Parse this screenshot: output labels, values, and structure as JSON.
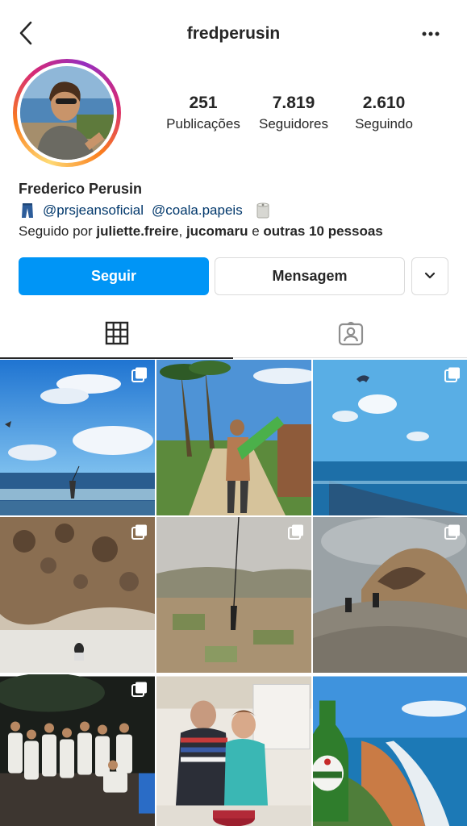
{
  "profile": {
    "username": "fredperusin",
    "name": "Frederico Perusin",
    "stats": [
      {
        "value": "251",
        "label": "Publicações"
      },
      {
        "value": "7.819",
        "label": "Seguidores"
      },
      {
        "value": "2.610",
        "label": "Seguindo"
      }
    ],
    "bio_tags": [
      "@prsjeansoficial",
      "@coala.papeis"
    ],
    "followed_by": {
      "prefix": "Seguido por",
      "user1": "juliette.freire",
      "sep": ",",
      "user2": "jucomaru",
      "and": "e",
      "others": "outras 10 pessoas"
    }
  },
  "actions": {
    "follow_label": "Seguir",
    "message_label": "Mensagem"
  },
  "icons": {
    "back": "back-arrow-icon",
    "more": "more-options-icon",
    "dropdown": "chevron-down-icon",
    "grid_tab": "grid-icon",
    "tagged_tab": "tagged-person-icon",
    "multi": "carousel-icon"
  },
  "colors": {
    "accent": "#0095f6",
    "link": "#00376b",
    "text": "#262626",
    "border": "#dbdbdb"
  },
  "posts": [
    {
      "scene": "kitesurf-ocean",
      "carousel": true
    },
    {
      "scene": "sandy-path-man-kiteboard",
      "carousel": false
    },
    {
      "scene": "kite-over-sea",
      "carousel": true
    },
    {
      "scene": "rock-cave-beach",
      "carousel": true
    },
    {
      "scene": "bungee-over-valley",
      "carousel": true
    },
    {
      "scene": "rocky-hill-hikers",
      "carousel": true
    },
    {
      "scene": "group-party-night",
      "carousel": true
    },
    {
      "scene": "couple-kitchen-cake",
      "carousel": false
    },
    {
      "scene": "beer-bottle-coast",
      "carousel": false
    }
  ]
}
